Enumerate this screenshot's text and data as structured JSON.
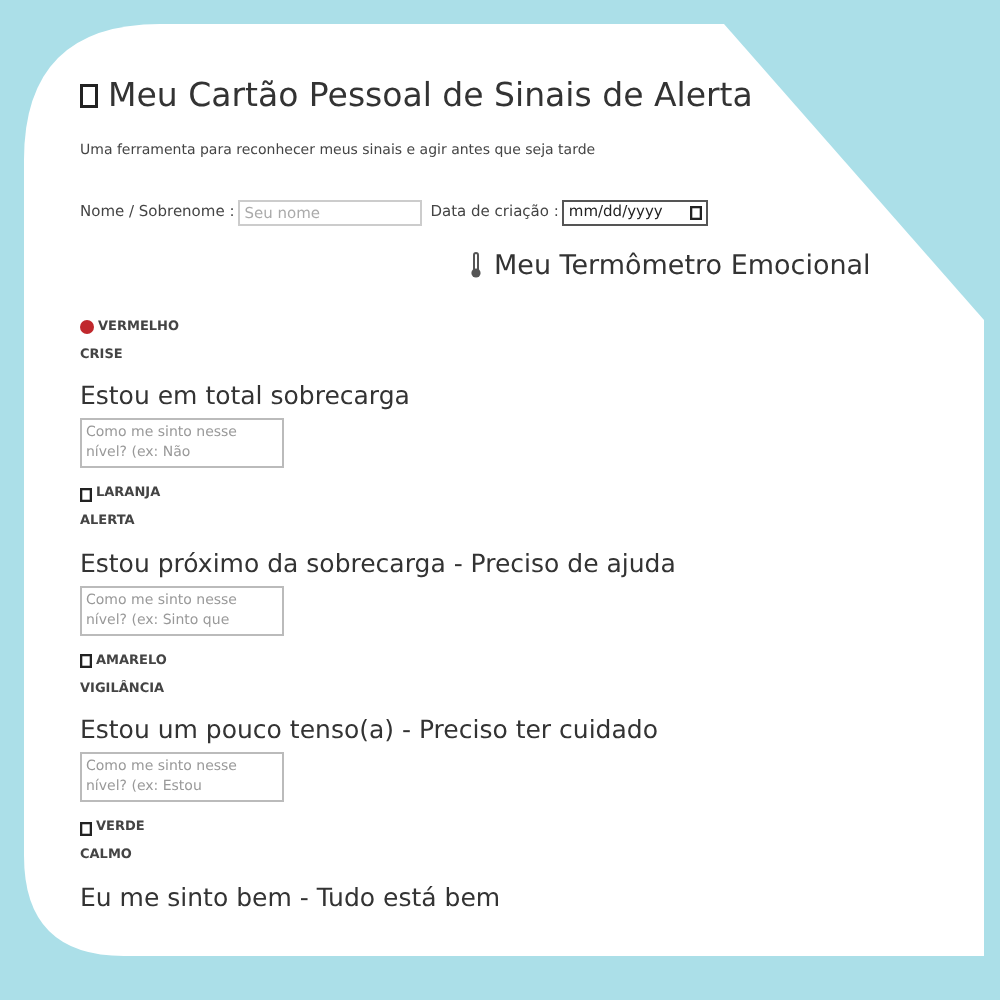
{
  "title": "Meu Cartão Pessoal de Sinais de Alerta",
  "subtitle": "Uma ferramenta para reconhecer meus sinais e agir antes que seja tarde",
  "form": {
    "name_label": "Nome / Sobrenome :",
    "name_placeholder": "Seu nome",
    "date_label": "Data de criação :",
    "date_placeholder": "mm/dd/yyyy"
  },
  "section_title": "Meu Termômetro Emocional",
  "levels": [
    {
      "kind": "dot",
      "color": "#c0282d",
      "name": "VERMELHO",
      "state": "CRISE",
      "heading": "Estou em total sobrecarga",
      "placeholder": "Como me sinto nesse nível? (ex: Não"
    },
    {
      "kind": "box",
      "name": "LARANJA",
      "state": "ALERTA",
      "heading": "Estou próximo da sobrecarga - Preciso de ajuda",
      "placeholder": "Como me sinto nesse nível? (ex: Sinto que"
    },
    {
      "kind": "box",
      "name": "AMARELO",
      "state": "VIGILÂNCIA",
      "heading": "Estou um pouco tenso(a) - Preciso ter cuidado",
      "placeholder": "Como me sinto nesse nível? (ex: Estou"
    },
    {
      "kind": "box",
      "name": "VERDE",
      "state": "CALMO",
      "heading": "Eu me sinto bem - Tudo está bem"
    }
  ]
}
